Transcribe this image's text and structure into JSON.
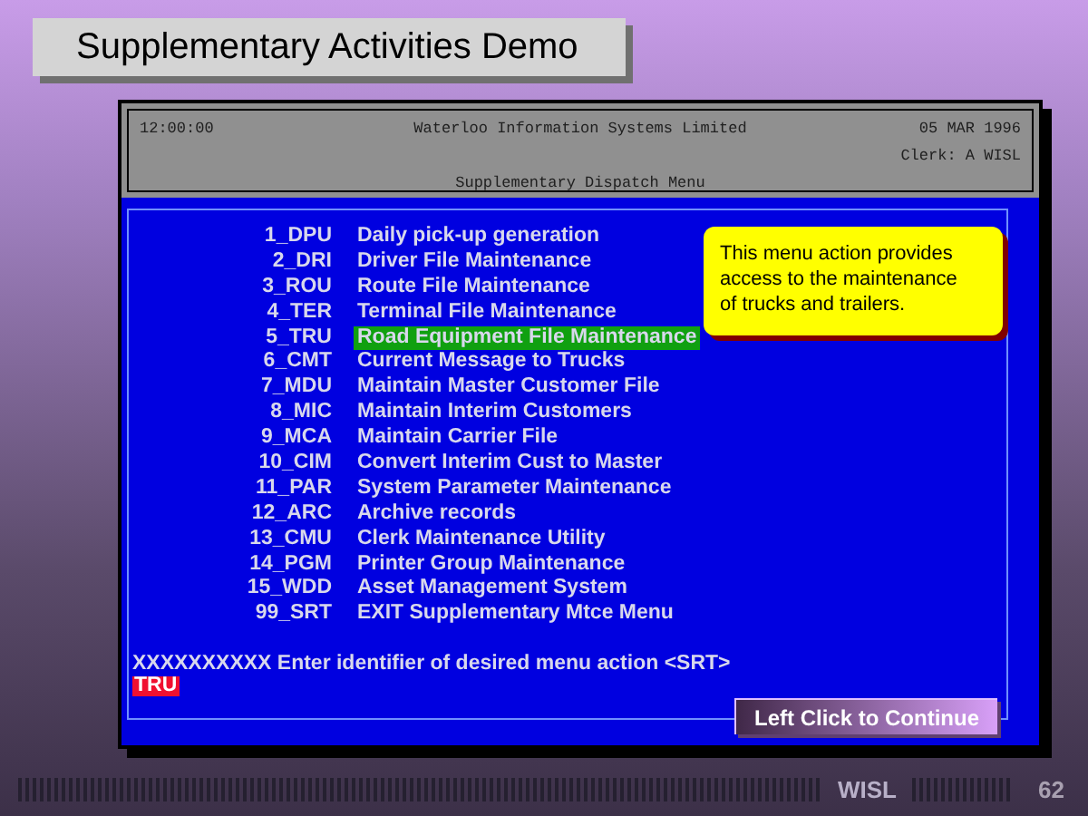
{
  "slide_title": "Supplementary Activities Demo",
  "header": {
    "time": "12:00:00",
    "company": "Waterloo Information Systems Limited",
    "date": "05 MAR 1996",
    "clerk": "Clerk:  A WISL",
    "menu_title": "Supplementary Dispatch Menu"
  },
  "menu_items": [
    {
      "code": "1_DPU",
      "label": "Daily pick-up generation",
      "selected": false
    },
    {
      "code": "2_DRI",
      "label": "Driver File Maintenance",
      "selected": false
    },
    {
      "code": "3_ROU",
      "label": "Route File Maintenance",
      "selected": false
    },
    {
      "code": "4_TER",
      "label": "Terminal File Maintenance",
      "selected": false
    },
    {
      "code": "5_TRU",
      "label": "Road Equipment File Maintenance",
      "selected": true
    },
    {
      "code": "6_CMT",
      "label": "Current Message to Trucks",
      "selected": false
    },
    {
      "code": "7_MDU",
      "label": "Maintain Master Customer File",
      "selected": false
    },
    {
      "code": "8_MIC",
      "label": "Maintain Interim Customers",
      "selected": false
    },
    {
      "code": "9_MCA",
      "label": "Maintain Carrier File",
      "selected": false
    },
    {
      "code": "10_CIM",
      "label": "Convert Interim Cust to Master",
      "selected": false
    },
    {
      "code": "11_PAR",
      "label": "System Parameter Maintenance",
      "selected": false
    },
    {
      "code": "12_ARC",
      "label": "Archive records",
      "selected": false
    },
    {
      "code": "13_CMU",
      "label": "Clerk Maintenance Utility",
      "selected": false
    },
    {
      "code": "14_PGM",
      "label": "Printer Group Maintenance",
      "selected": false
    },
    {
      "code": "15_WDD",
      "label": "Asset Management System",
      "selected": false
    },
    {
      "code": "99_SRT",
      "label": "EXIT Supplementary Mtce Menu",
      "selected": false
    }
  ],
  "prompt": "XXXXXXXXXX Enter identifier of desired menu action <SRT>",
  "input_value": "TRU",
  "tooltip": "This menu action provides access to the maintenance of trucks and trailers.",
  "continue_button": "Left Click to Continue",
  "footer": {
    "brand": "WISL",
    "page": "62"
  }
}
